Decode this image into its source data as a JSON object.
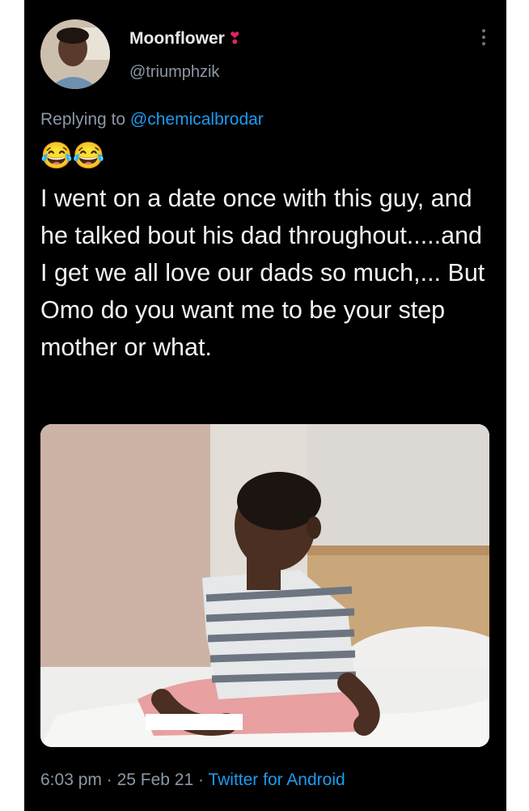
{
  "author": {
    "display_name": "Moonflower",
    "name_emoji": "❣",
    "handle": "@triumphzik"
  },
  "reply": {
    "prefix": "Replying to ",
    "mention": "@chemicalbrodar"
  },
  "tweet": {
    "emojis": "😂😂",
    "text": "I went on a date once with this guy, and he talked bout his dad throughout.....and I get we all love our dads so much,... But Omo do you want me to be your step mother or what."
  },
  "meta": {
    "time": "6:03 pm",
    "separator": " · ",
    "date": "25 Feb 21",
    "source": "Twitter for Android"
  },
  "colors": {
    "background": "#000000",
    "text": "#e7e9ea",
    "secondary": "#8b98a5",
    "link": "#1d9bf0",
    "heart": "#e0245e"
  },
  "icons": {
    "more": "more-vertical-icon"
  }
}
